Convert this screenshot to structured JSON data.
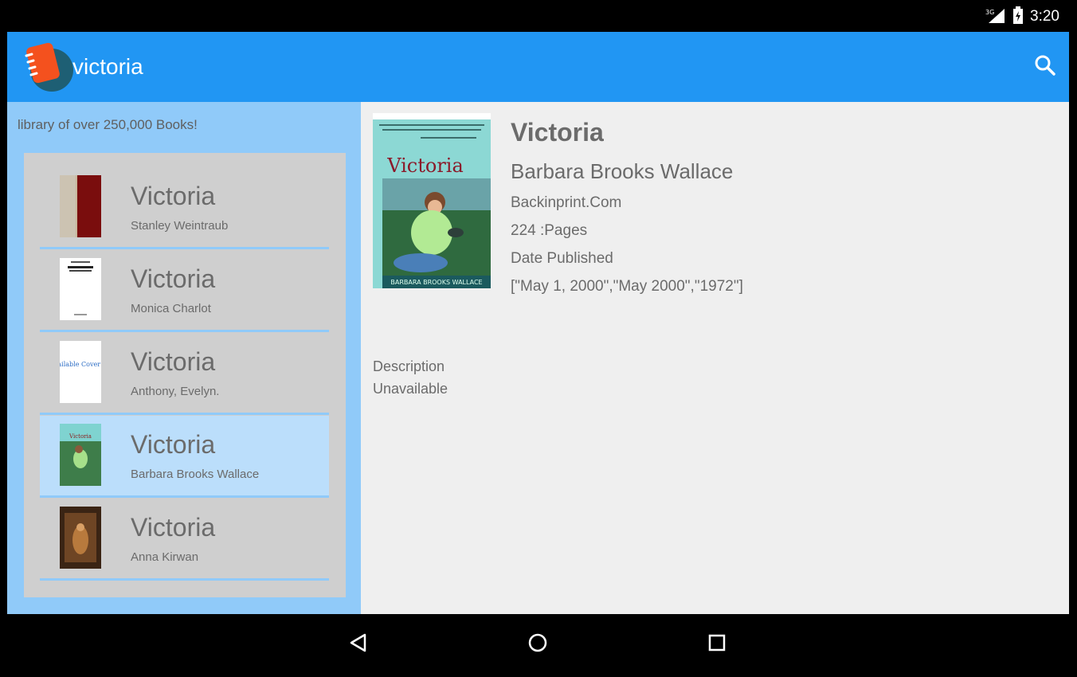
{
  "status_bar": {
    "time": "3:20",
    "network_label": "3G"
  },
  "toolbar": {
    "title": "victoria"
  },
  "left_pane": {
    "tagline": "library of over 250,000 Books!",
    "books": [
      {
        "title": "Victoria",
        "author": "Stanley Weintraub"
      },
      {
        "title": "Victoria",
        "author": "Monica Charlot"
      },
      {
        "title": "Victoria",
        "author": "Anthony, Evelyn."
      },
      {
        "title": "Victoria",
        "author": "Barbara Brooks Wallace"
      },
      {
        "title": "Victoria",
        "author": "Anna Kirwan"
      }
    ],
    "no_cover_text": "No Available Cover Image",
    "cover_title_text": "Victoria"
  },
  "detail": {
    "title": "Victoria",
    "author": "Barbara Brooks Wallace",
    "publisher": "Backinprint.Com",
    "pages": "224 :Pages",
    "date_label": "Date Published",
    "dates": "[\"May 1, 2000\",\"May 2000\",\"1972\"]",
    "cover_title": "Victoria",
    "cover_author": "BARBARA BROOKS WALLACE",
    "description_label": "Description",
    "description_text": "Unavailable"
  },
  "colors": {
    "primary": "#2196f3",
    "pane_blue": "#90caf9",
    "selected": "#bbdefb",
    "list_bg": "#cfcfcf",
    "text": "#6b6b6b",
    "logo_orange": "#f4511e",
    "logo_teal": "#1e5f74"
  }
}
